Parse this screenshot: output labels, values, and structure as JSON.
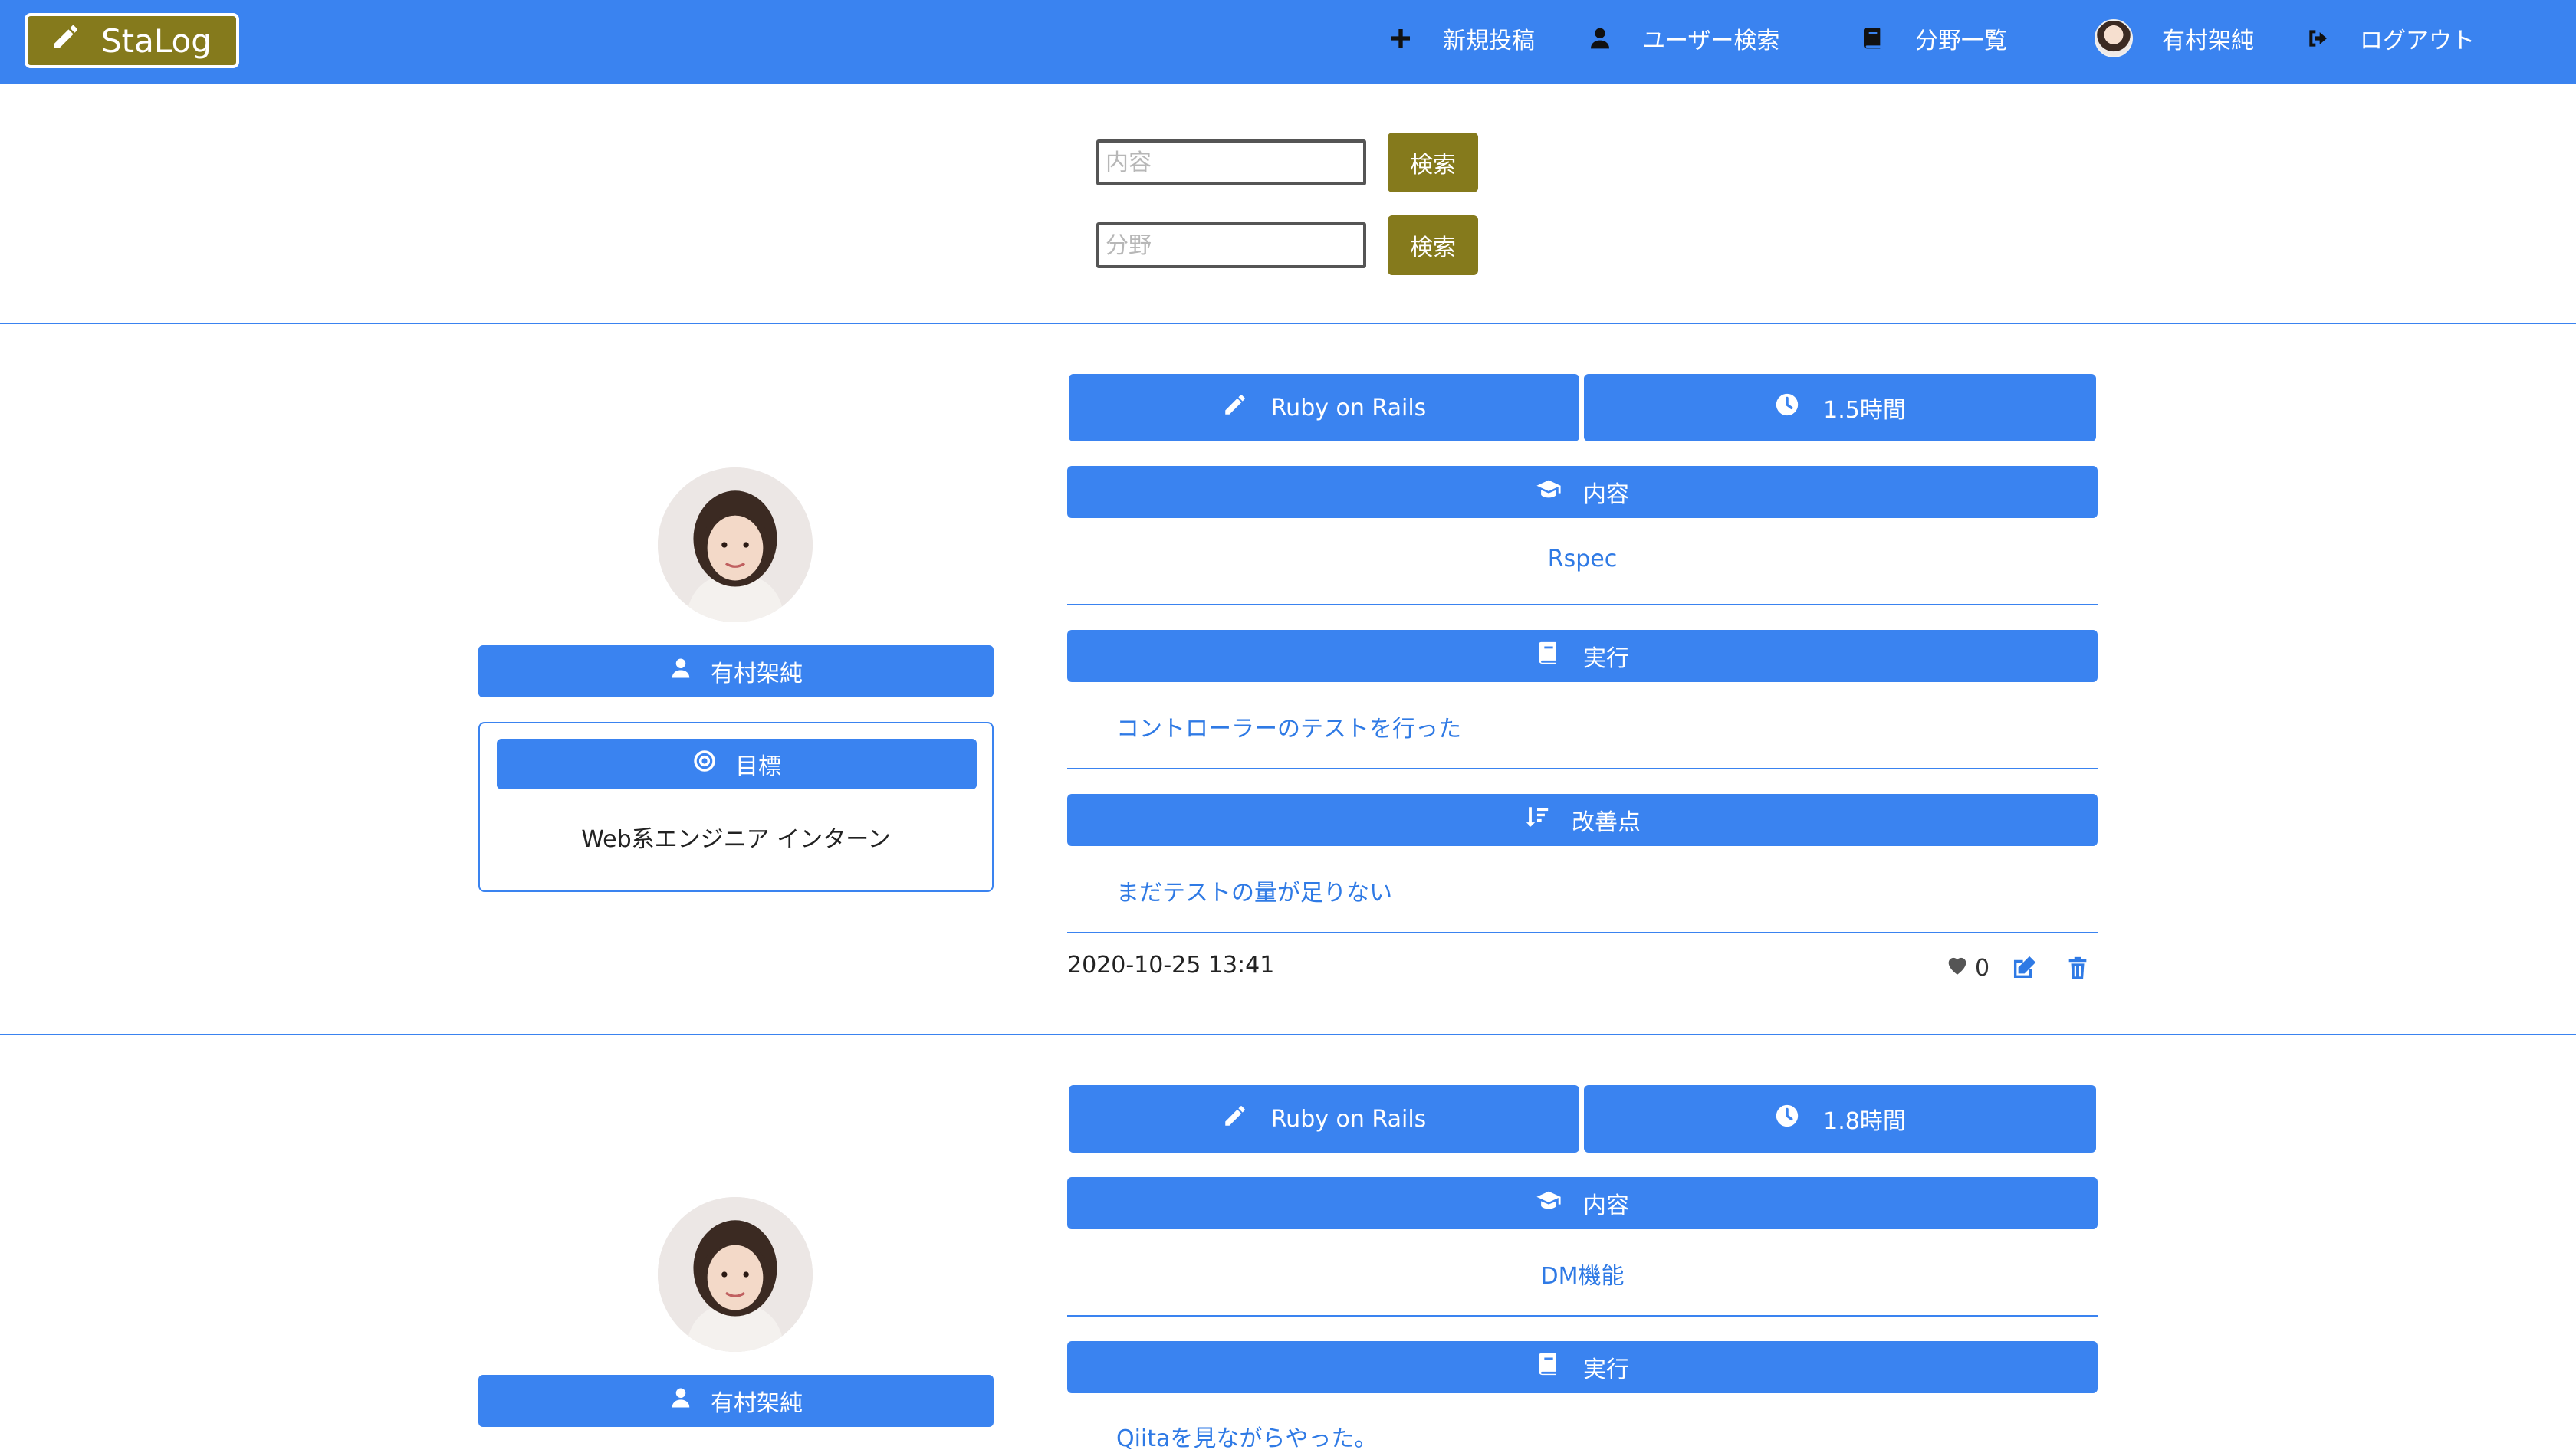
{
  "navbar": {
    "brand": "StaLog",
    "items": [
      {
        "label": "新規投稿",
        "icon": "plus-icon"
      },
      {
        "label": "ユーザー検索",
        "icon": "user-icon"
      },
      {
        "label": "分野一覧",
        "icon": "book-icon"
      },
      {
        "label": "有村架純",
        "icon": "avatar"
      },
      {
        "label": "ログアウト",
        "icon": "sign-out-icon"
      }
    ]
  },
  "search": {
    "content_placeholder": "内容",
    "field_placeholder": "分野",
    "button_label": "検索"
  },
  "posts": [
    {
      "user_name": "有村架純",
      "goal_label": "目標",
      "goal_text": "Web系エンジニア インターン",
      "category": "Ruby on Rails",
      "duration": "1.5時間",
      "content_label": "内容",
      "content": "Rspec",
      "execution_label": "実行",
      "execution": "コントローラーのテストを行った",
      "improvement_label": "改善点",
      "improvement": "まだテストの量が足りない",
      "date": "2020-10-25 13:41",
      "likes": "0"
    },
    {
      "user_name": "有村架純",
      "category": "Ruby on Rails",
      "duration": "1.8時間",
      "content_label": "内容",
      "content": "DM機能",
      "execution_label": "実行",
      "execution": "Qiitaを見ながらやった。"
    }
  ],
  "colors": {
    "primary": "#3a83f0",
    "olive": "#857a1c"
  }
}
